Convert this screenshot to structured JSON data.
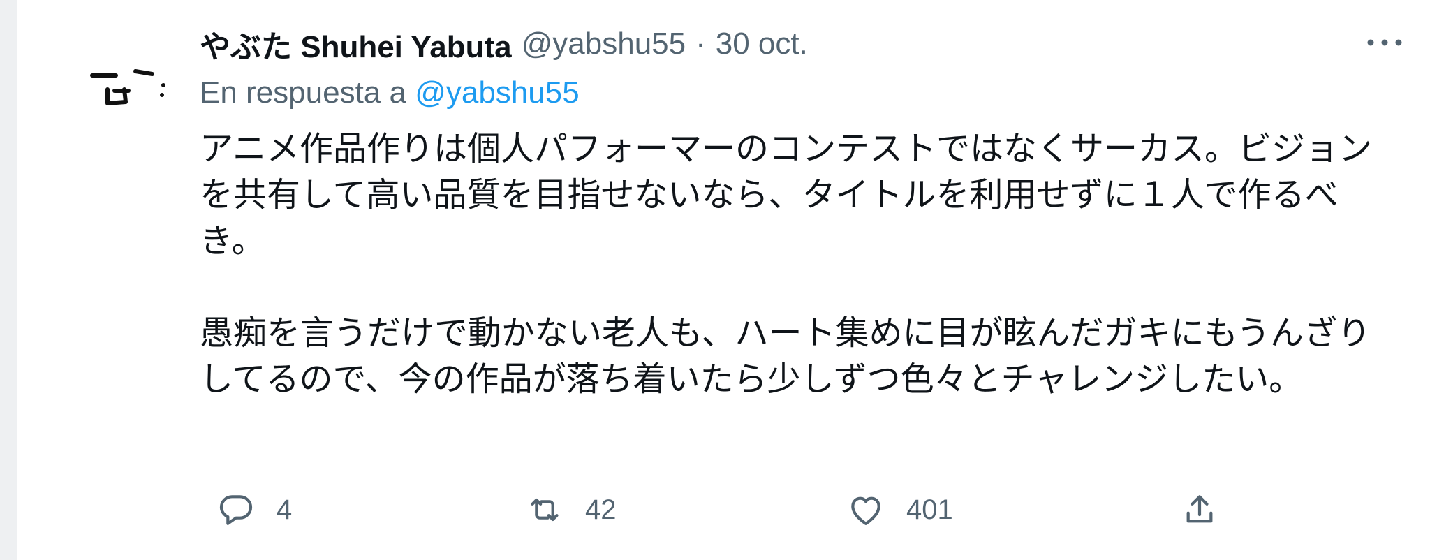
{
  "tweet": {
    "display_name": "やぶた Shuhei Yabuta",
    "handle": "@yabshu55",
    "separator": "·",
    "date": "30 oct.",
    "reply_prefix": "En respuesta a",
    "reply_to": "@yabshu55",
    "paragraphs": [
      "アニメ作品作りは個人パフォーマーのコンテストではなくサーカス。ビジョンを共有して高い品質を目指せないなら、タイトルを利用せずに１人で作るべき。",
      "愚痴を言うだけで動かない老人も、ハート集めに目が眩んだガキにもうんざりしてるので、今の作品が落ち着いたら少しずつ色々とチャレンジしたい。"
    ],
    "counts": {
      "replies": "4",
      "retweets": "42",
      "likes": "401"
    }
  },
  "icons": {
    "more": "more-horizontal-icon",
    "reply": "reply-icon",
    "retweet": "retweet-icon",
    "like": "heart-icon",
    "share": "share-icon"
  },
  "colors": {
    "text": "#0f1419",
    "secondary": "#536471",
    "link": "#1d9bf0"
  }
}
